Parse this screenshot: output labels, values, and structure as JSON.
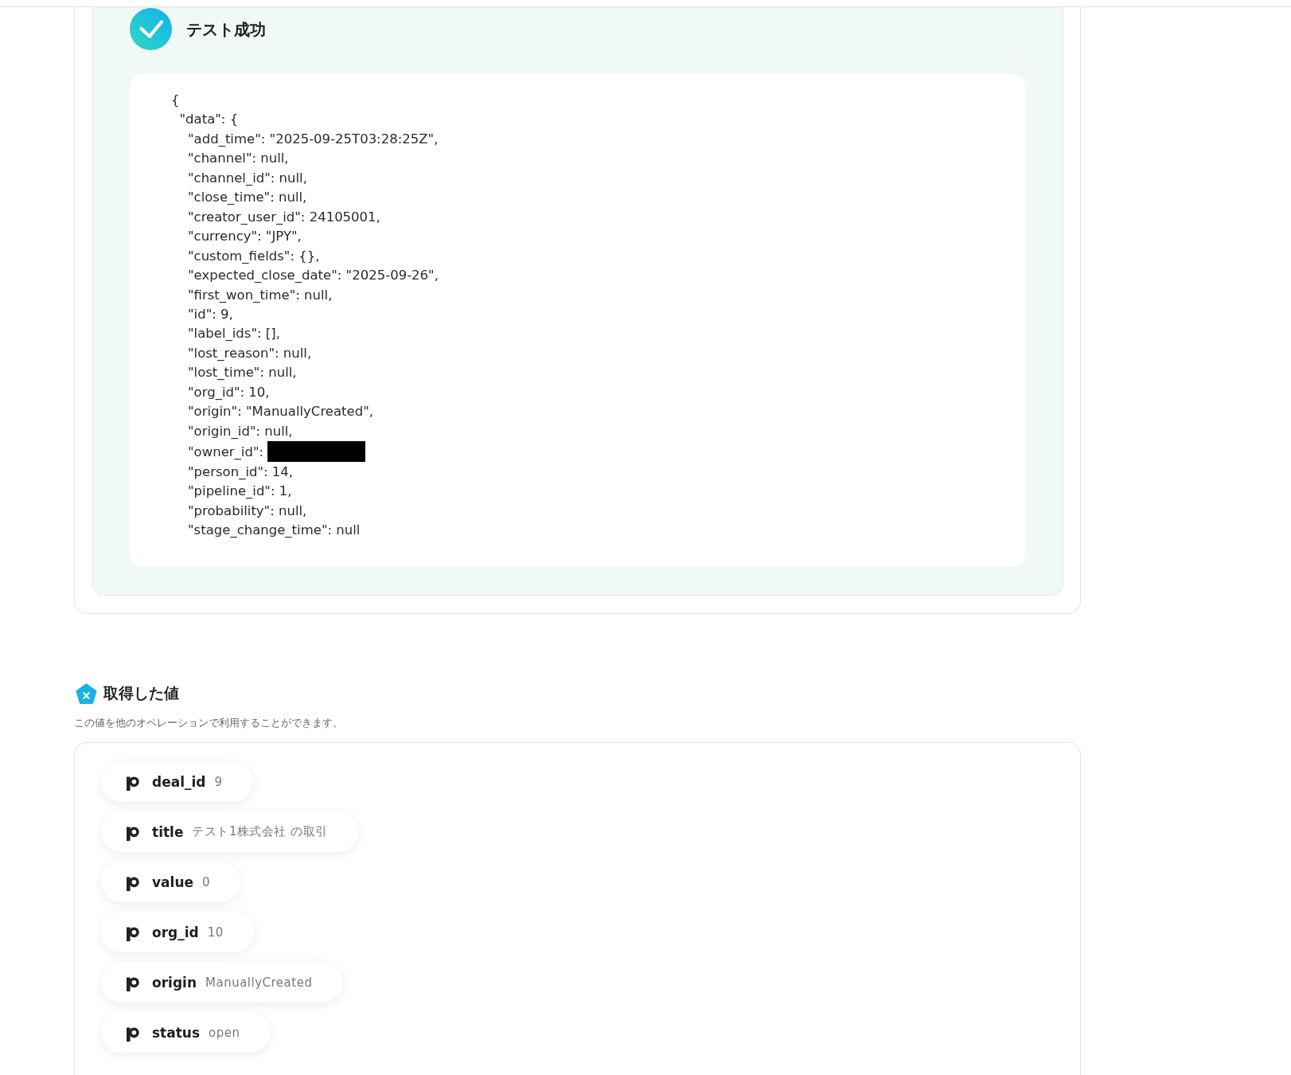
{
  "test_result": {
    "title": "テスト成功",
    "code": [
      {
        "text": "{",
        "redacted": false,
        "children": [
          {
            "text": "\"data\": {",
            "redacted": false,
            "children": [
              {
                "text": "\"add_time\": \"2025-09-25T03:28:25Z\",",
                "redacted": false
              },
              {
                "text": "\"channel\": null,",
                "redacted": false
              },
              {
                "text": "\"channel_id\": null,",
                "redacted": false
              },
              {
                "text": "\"close_time\": null,",
                "redacted": false
              },
              {
                "text": "\"creator_user_id\": 24105001,",
                "redacted": false
              },
              {
                "text": "\"currency\": \"JPY\",",
                "redacted": false
              },
              {
                "text": "\"custom_fields\": {},",
                "redacted": false
              },
              {
                "text": "\"expected_close_date\": \"2025-09-26\",",
                "redacted": false
              },
              {
                "text": "\"first_won_time\": null,",
                "redacted": false
              },
              {
                "text": "\"id\": 9,",
                "redacted": false
              },
              {
                "text": "\"label_ids\": [],",
                "redacted": false
              },
              {
                "text": "\"lost_reason\": null,",
                "redacted": false
              },
              {
                "text": "\"lost_time\": null,",
                "redacted": false
              },
              {
                "text": "\"org_id\": 10,",
                "redacted": false
              },
              {
                "text": "\"origin\": \"ManuallyCreated\",",
                "redacted": false
              },
              {
                "text": "\"origin_id\": null,",
                "redacted": false
              },
              {
                "text": "\"owner_id\":",
                "redacted": true
              },
              {
                "text": "\"person_id\": 14,",
                "redacted": false
              },
              {
                "text": "\"pipeline_id\": 1,",
                "redacted": false
              },
              {
                "text": "\"probability\": null,",
                "redacted": false
              },
              {
                "text": "\"stage_change_time\": null",
                "redacted": false
              }
            ]
          }
        ]
      }
    ]
  },
  "retrieved_values": {
    "title": "取得した値",
    "description": "この値を他のオペレーションで利用することができます。",
    "items": [
      {
        "name": "deal_id",
        "value": "9"
      },
      {
        "name": "title",
        "value": "テスト1株式会社 の取引"
      },
      {
        "name": "value",
        "value": "0"
      },
      {
        "name": "org_id",
        "value": "10"
      },
      {
        "name": "origin",
        "value": "ManuallyCreated"
      },
      {
        "name": "status",
        "value": "open"
      }
    ]
  }
}
